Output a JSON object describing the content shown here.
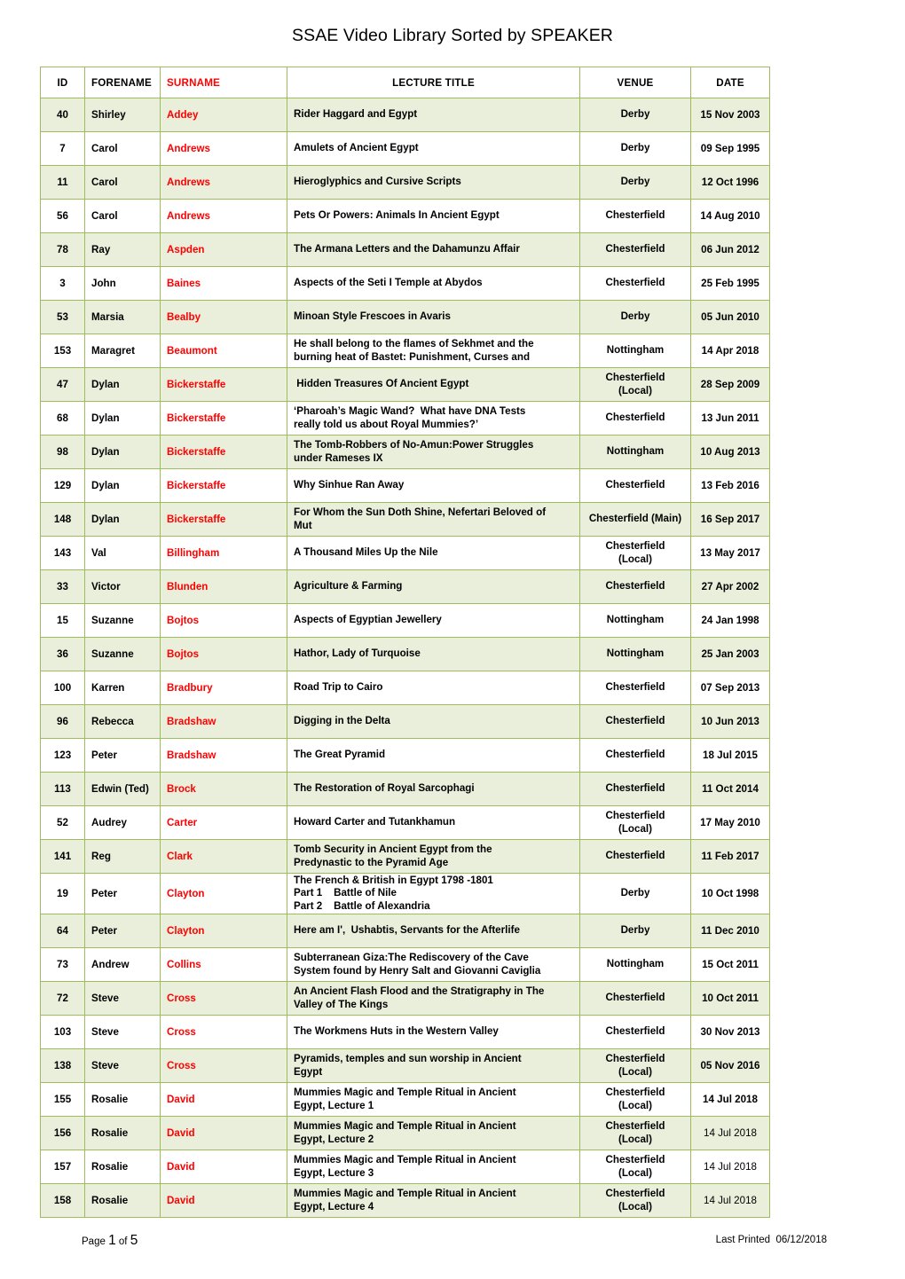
{
  "document": {
    "title": "SSAE Video Library Sorted by SPEAKER"
  },
  "colors": {
    "surname_accent": "#ff0000",
    "row_tint": "#e9efdb",
    "border": "#9fbc5c",
    "text": "#000000"
  },
  "table": {
    "headers": {
      "id": "ID",
      "forename": "FORENAME",
      "surname": "SURNAME",
      "lecture_title": "LECTURE TITLE",
      "venue": "VENUE",
      "date": "DATE"
    },
    "rows": [
      {
        "id": "40",
        "forename": "Shirley",
        "surname": "Addey",
        "title": [
          "Rider Haggard and Egypt"
        ],
        "venue": [
          "Derby"
        ],
        "date": "15 Nov 2003"
      },
      {
        "id": "7",
        "forename": "Carol",
        "surname": "Andrews",
        "title": [
          "Amulets of Ancient Egypt"
        ],
        "venue": [
          "Derby"
        ],
        "date": "09 Sep 1995"
      },
      {
        "id": "11",
        "forename": "Carol",
        "surname": "Andrews",
        "title": [
          "Hieroglyphics and Cursive Scripts"
        ],
        "venue": [
          "Derby"
        ],
        "date": "12 Oct 1996"
      },
      {
        "id": "56",
        "forename": "Carol",
        "surname": "Andrews",
        "title": [
          "Pets Or Powers: Animals In Ancient Egypt"
        ],
        "venue": [
          "Chesterfield"
        ],
        "date": "14 Aug 2010"
      },
      {
        "id": "78",
        "forename": "Ray",
        "surname": "Aspden",
        "title": [
          "The Armana Letters and the Dahamunzu Affair"
        ],
        "venue": [
          "Chesterfield"
        ],
        "date": "06 Jun 2012"
      },
      {
        "id": "3",
        "forename": "John",
        "surname": "Baines",
        "title": [
          "Aspects of the Seti I Temple at Abydos"
        ],
        "venue": [
          "Chesterfield"
        ],
        "date": "25 Feb 1995"
      },
      {
        "id": "53",
        "forename": "Marsia",
        "surname": "Bealby",
        "title": [
          "Minoan Style Frescoes in Avaris"
        ],
        "venue": [
          "Derby"
        ],
        "date": "05 Jun 2010"
      },
      {
        "id": "153",
        "forename": "Maragret",
        "surname": "Beaumont",
        "title": [
          "He shall belong to the flames of Sekhmet and the",
          "burning heat of Bastet: Punishment, Curses and"
        ],
        "venue": [
          "Nottingham"
        ],
        "date": "14 Apr 2018"
      },
      {
        "id": "47",
        "forename": "Dylan",
        "surname": "Bickerstaffe",
        "title": [
          " Hidden Treasures Of Ancient Egypt"
        ],
        "venue": [
          "Chesterfield",
          "(Local)"
        ],
        "date": "28 Sep 2009"
      },
      {
        "id": "68",
        "forename": "Dylan",
        "surname": "Bickerstaffe",
        "title": [
          "‘Pharoah’s Magic Wand?  What have DNA Tests",
          "really told us about Royal Mummies?’"
        ],
        "venue": [
          "Chesterfield"
        ],
        "date": "13 Jun 2011"
      },
      {
        "id": "98",
        "forename": "Dylan",
        "surname": "Bickerstaffe",
        "title": [
          "The Tomb-Robbers of No-Amun:Power Struggles",
          "under Rameses IX"
        ],
        "venue": [
          "Nottingham"
        ],
        "date": "10 Aug 2013"
      },
      {
        "id": "129",
        "forename": "Dylan",
        "surname": "Bickerstaffe",
        "title": [
          "Why Sinhue Ran Away"
        ],
        "venue": [
          "Chesterfield"
        ],
        "date": "13 Feb 2016"
      },
      {
        "id": "148",
        "forename": "Dylan",
        "surname": "Bickerstaffe",
        "title": [
          "For Whom the Sun Doth Shine, Nefertari Beloved of",
          "Mut"
        ],
        "venue": [
          "Chesterfield (Main)"
        ],
        "date": "16 Sep 2017"
      },
      {
        "id": "143",
        "forename": "Val",
        "surname": "Billingham",
        "title": [
          "A Thousand Miles Up the Nile"
        ],
        "venue": [
          "Chesterfield",
          "(Local)"
        ],
        "date": "13 May 2017"
      },
      {
        "id": "33",
        "forename": "Victor",
        "surname": "Blunden",
        "title": [
          "Agriculture & Farming"
        ],
        "venue": [
          "Chesterfield"
        ],
        "date": "27 Apr 2002"
      },
      {
        "id": "15",
        "forename": "Suzanne",
        "surname": "Bojtos",
        "title": [
          "Aspects of Egyptian Jewellery"
        ],
        "venue": [
          "Nottingham"
        ],
        "date": "24 Jan 1998"
      },
      {
        "id": "36",
        "forename": "Suzanne",
        "surname": "Bojtos",
        "title": [
          "Hathor, Lady of Turquoise"
        ],
        "venue": [
          "Nottingham"
        ],
        "date": "25 Jan 2003"
      },
      {
        "id": "100",
        "forename": "Karren",
        "surname": "Bradbury",
        "title": [
          "Road Trip to Cairo"
        ],
        "venue": [
          "Chesterfield"
        ],
        "date": "07 Sep 2013"
      },
      {
        "id": "96",
        "forename": "Rebecca",
        "surname": "Bradshaw",
        "title": [
          "Digging in the Delta"
        ],
        "venue": [
          "Chesterfield"
        ],
        "date": "10 Jun 2013"
      },
      {
        "id": "123",
        "forename": "Peter",
        "surname": "Bradshaw",
        "title": [
          "The Great Pyramid"
        ],
        "venue": [
          "Chesterfield"
        ],
        "date": "18 Jul 2015"
      },
      {
        "id": "113",
        "forename": "Edwin (Ted)",
        "surname": "Brock",
        "title": [
          "The Restoration of Royal Sarcophagi"
        ],
        "venue": [
          "Chesterfield"
        ],
        "date": "11 Oct 2014"
      },
      {
        "id": "52",
        "forename": "Audrey",
        "surname": "Carter",
        "title": [
          "Howard Carter and Tutankhamun"
        ],
        "venue": [
          "Chesterfield",
          "(Local)"
        ],
        "date": "17 May 2010"
      },
      {
        "id": "141",
        "forename": "Reg",
        "surname": "Clark",
        "title": [
          "Tomb Security in Ancient Egypt from the",
          "Predynastic to the Pyramid Age"
        ],
        "venue": [
          "Chesterfield"
        ],
        "date": "11 Feb 2017"
      },
      {
        "id": "19",
        "forename": "Peter",
        "surname": "Clayton",
        "title": [
          "The French & British in Egypt 1798 -1801",
          "Part 1    Battle of Nile",
          "Part 2    Battle of Alexandria"
        ],
        "venue": [
          "Derby"
        ],
        "date": "10 Oct 1998"
      },
      {
        "id": "64",
        "forename": "Peter",
        "surname": "Clayton",
        "title": [
          "Here am I',  Ushabtis, Servants for the Afterlife"
        ],
        "venue": [
          "Derby"
        ],
        "date": "11 Dec 2010"
      },
      {
        "id": "73",
        "forename": "Andrew",
        "surname": "Collins",
        "title": [
          "Subterranean Giza:The Rediscovery of the Cave",
          "System found by Henry Salt and Giovanni Caviglia"
        ],
        "venue": [
          "Nottingham"
        ],
        "date": "15 Oct 2011"
      },
      {
        "id": "72",
        "forename": "Steve",
        "surname": "Cross",
        "title": [
          "An Ancient Flash Flood and the Stratigraphy in The",
          "Valley of The Kings"
        ],
        "venue": [
          "Chesterfield"
        ],
        "date": "10 Oct 2011"
      },
      {
        "id": "103",
        "forename": "Steve",
        "surname": "Cross",
        "title": [
          "The Workmens Huts in the Western Valley"
        ],
        "venue": [
          "Chesterfield"
        ],
        "date": "30 Nov 2013"
      },
      {
        "id": "138",
        "forename": "Steve",
        "surname": "Cross",
        "title": [
          "Pyramids, temples and sun worship in Ancient",
          "Egypt"
        ],
        "venue": [
          "Chesterfield",
          "(Local)"
        ],
        "date": "05 Nov 2016"
      },
      {
        "id": "155",
        "forename": "Rosalie",
        "surname": "David",
        "title": [
          "Mummies Magic and Temple Ritual in Ancient",
          "Egypt, Lecture 1"
        ],
        "venue": [
          "Chesterfield",
          "(Local)"
        ],
        "date": "14 Jul 2018"
      },
      {
        "id": "156",
        "forename": "Rosalie",
        "surname": "David",
        "title": [
          "Mummies Magic and Temple Ritual in Ancient",
          "Egypt, Lecture 2"
        ],
        "venue": [
          "Chesterfield",
          "(Local)"
        ],
        "date": "14 Jul 2018",
        "date_thin": true
      },
      {
        "id": "157",
        "forename": "Rosalie",
        "surname": "David",
        "title": [
          "Mummies Magic and Temple Ritual in Ancient",
          "Egypt, Lecture 3"
        ],
        "venue": [
          "Chesterfield",
          "(Local)"
        ],
        "date": "14 Jul 2018",
        "date_thin": true
      },
      {
        "id": "158",
        "forename": "Rosalie",
        "surname": "David",
        "title": [
          "Mummies Magic and Temple Ritual in Ancient",
          "Egypt, Lecture 4"
        ],
        "venue": [
          "Chesterfield",
          "(Local)"
        ],
        "date": "14 Jul 2018",
        "date_thin": true
      }
    ]
  },
  "footer": {
    "page_word": "Page",
    "page_number": "1",
    "of_word": "of",
    "page_total": "5",
    "last_printed_label": "Last Printed",
    "last_printed_date": "06/12/2018"
  }
}
